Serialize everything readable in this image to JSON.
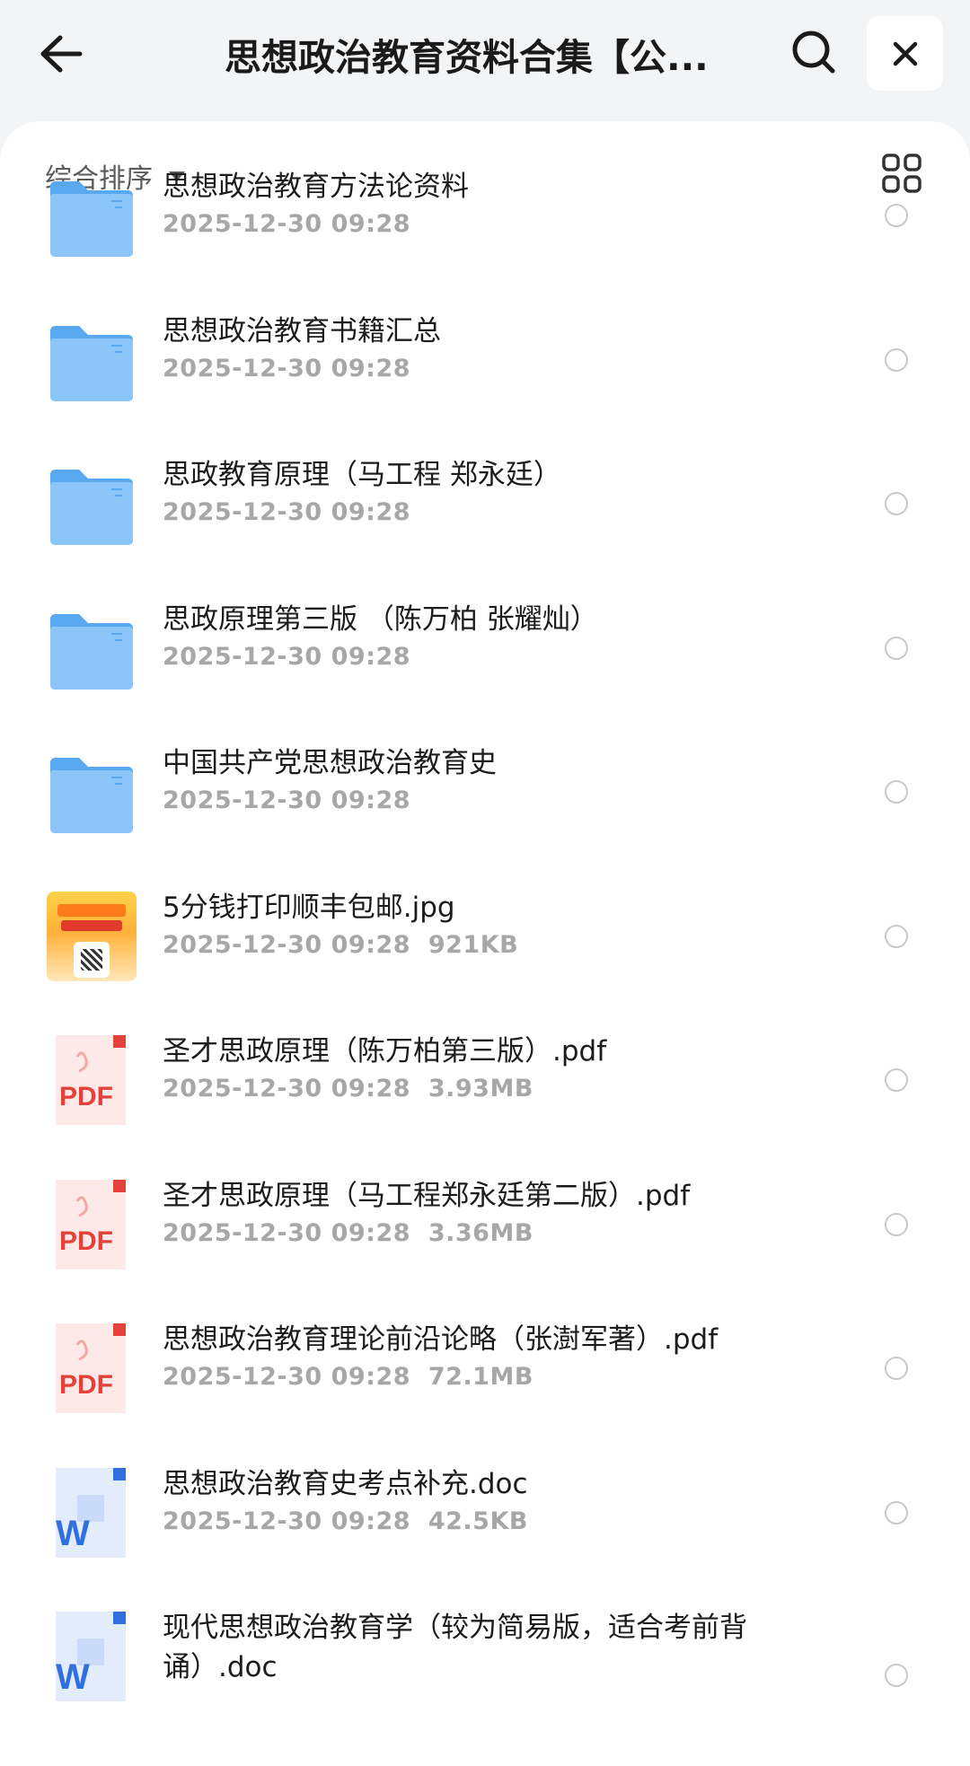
{
  "header": {
    "title": "思想政治教育资料合集【公...",
    "back_icon": "arrow-left-icon",
    "search_icon": "search-icon",
    "close_icon": "close-icon"
  },
  "toolbar": {
    "sort_label": "综合排序",
    "view_icon": "grid-view-icon"
  },
  "colors": {
    "folder": "#6fb6f5",
    "pdf": "#e4413a",
    "word": "#2f6fe0",
    "meta_text": "#a7a7a7"
  },
  "files": [
    {
      "type": "folder",
      "icon": "folder-icon",
      "name": "思想政治教育方法论资料",
      "meta": "2025-12-30 09:28"
    },
    {
      "type": "folder",
      "icon": "folder-icon",
      "name": "思想政治教育书籍汇总",
      "meta": "2025-12-30 09:28"
    },
    {
      "type": "folder",
      "icon": "folder-icon",
      "name": "思政教育原理（马工程 郑永廷）",
      "meta": "2025-12-30 09:28"
    },
    {
      "type": "folder",
      "icon": "folder-icon",
      "name": "思政原理第三版 （陈万柏 张耀灿）",
      "meta": "2025-12-30 09:28"
    },
    {
      "type": "folder",
      "icon": "folder-icon",
      "name": "中国共产党思想政治教育史",
      "meta": "2025-12-30 09:28"
    },
    {
      "type": "image",
      "icon": "image-thumbnail-icon",
      "name": "5分钱打印顺丰包邮.jpg",
      "meta": "2025-12-30 09:28  921KB"
    },
    {
      "type": "pdf",
      "icon": "pdf-file-icon",
      "name": "圣才思政原理（陈万柏第三版）.pdf",
      "meta": "2025-12-30 09:28  3.93MB"
    },
    {
      "type": "pdf",
      "icon": "pdf-file-icon",
      "name": "圣才思政原理（马工程郑永廷第二版）.pdf",
      "meta": "2025-12-30 09:28  3.36MB"
    },
    {
      "type": "pdf",
      "icon": "pdf-file-icon",
      "name": "思想政治教育理论前沿论略（张澍军著）.pdf",
      "meta": "2025-12-30 09:28  72.1MB"
    },
    {
      "type": "doc",
      "icon": "word-file-icon",
      "name": "思想政治教育史考点补充.doc",
      "meta": "2025-12-30 09:28  42.5KB"
    },
    {
      "type": "doc",
      "icon": "word-file-icon",
      "name": "现代思想政治教育学（较为简易版，适合考前背诵）.doc",
      "meta": ""
    }
  ]
}
